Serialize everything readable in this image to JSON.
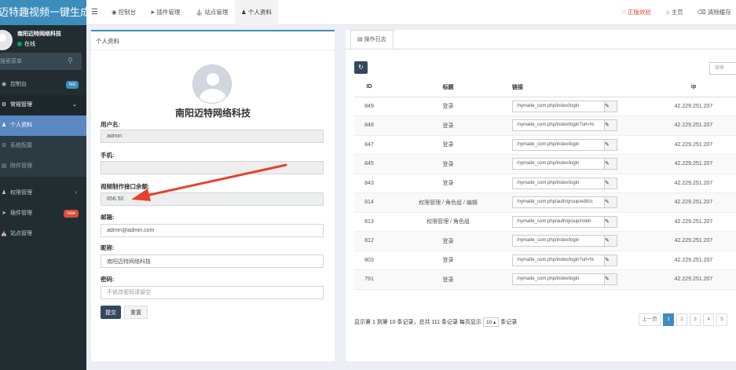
{
  "app": {
    "brand": "迈特趣视频一键生成"
  },
  "user": {
    "name": "南阳迈特网络科技",
    "status": "在线"
  },
  "sidebar": {
    "search_placeholder": "搜索菜单",
    "items": [
      {
        "label": "控制台",
        "badge": "hot",
        "badge_color": "#3c8dbc"
      },
      {
        "label": "常规管理"
      },
      {
        "label": "个人资料"
      },
      {
        "label": "系统配置"
      },
      {
        "label": "附件管理"
      },
      {
        "label": "权限管理"
      },
      {
        "label": "插件管理",
        "badge": "new",
        "badge_color": "#dd4b39"
      },
      {
        "label": "站点管理"
      }
    ]
  },
  "topbar": {
    "tabs": [
      "控制台",
      "插件管理",
      "站点管理",
      "个人资料"
    ],
    "genuine": "正版效验",
    "home": "主页",
    "clear_cache": "清除缓存"
  },
  "profile": {
    "box_title": "个人资料",
    "display_name": "南阳迈特网络科技",
    "username_label": "用户名:",
    "username_value": "admin",
    "phone_label": "手机:",
    "phone_value": "",
    "balance_label": "视频制作接口余额:",
    "balance_value": "856.50",
    "email_label": "邮箱:",
    "email_value": "admin@admin.com",
    "nickname_label": "昵称:",
    "nickname_value": "南阳迈特网络科技",
    "password_label": "密码:",
    "password_placeholder": "不修改密码请留空",
    "submit": "提交",
    "reset": "重置"
  },
  "log": {
    "tab": "操作日志",
    "search_placeholder": "搜索",
    "headers": {
      "id": "ID",
      "title": "标题",
      "link": "链接",
      "ip": "ip"
    },
    "rows": [
      {
        "id": "849",
        "title": "登录",
        "url": "/nymaite_com.php/index/login",
        "ip": "42.229.251.207"
      },
      {
        "id": "848",
        "title": "登录",
        "url": "/nymaite_com.php/index/login?url=%",
        "ip": "42.229.251.207"
      },
      {
        "id": "847",
        "title": "登录",
        "url": "/nymaite_com.php/index/login",
        "ip": "42.229.251.207"
      },
      {
        "id": "845",
        "title": "登录",
        "url": "/nymaite_com.php/index/login",
        "ip": "42.229.251.207"
      },
      {
        "id": "843",
        "title": "登录",
        "url": "/nymaite_com.php/index/login",
        "ip": "42.229.251.207"
      },
      {
        "id": "814",
        "title": "权限管理 / 角色组 / 编辑",
        "url": "/nymaite_com.php/auth/group/edit/ic",
        "ip": "42.229.251.207"
      },
      {
        "id": "813",
        "title": "权限管理 / 角色组",
        "url": "/nymaite_com.php/auth/group/roletr",
        "ip": "42.229.251.207"
      },
      {
        "id": "812",
        "title": "登录",
        "url": "/nymaite_com.php/index/login",
        "ip": "42.229.251.207"
      },
      {
        "id": "803",
        "title": "登录",
        "url": "/nymaite_com.php/index/login?url=%",
        "ip": "42.229.251.207"
      },
      {
        "id": "791",
        "title": "登录",
        "url": "/nymaite_com.php/index/login",
        "ip": "42.229.251.207"
      }
    ],
    "pager": {
      "info_prefix": "显示第 1 到第 10 条记录，总共 111 条记录 每页显示",
      "page_size": "10 ▴",
      "info_suffix": "条记录",
      "prev": "上一页",
      "pages": [
        "1",
        "2",
        "3",
        "4",
        "5"
      ]
    }
  },
  "colors": {
    "accent": "#3c8dbc",
    "arrow": "#e8412c"
  }
}
